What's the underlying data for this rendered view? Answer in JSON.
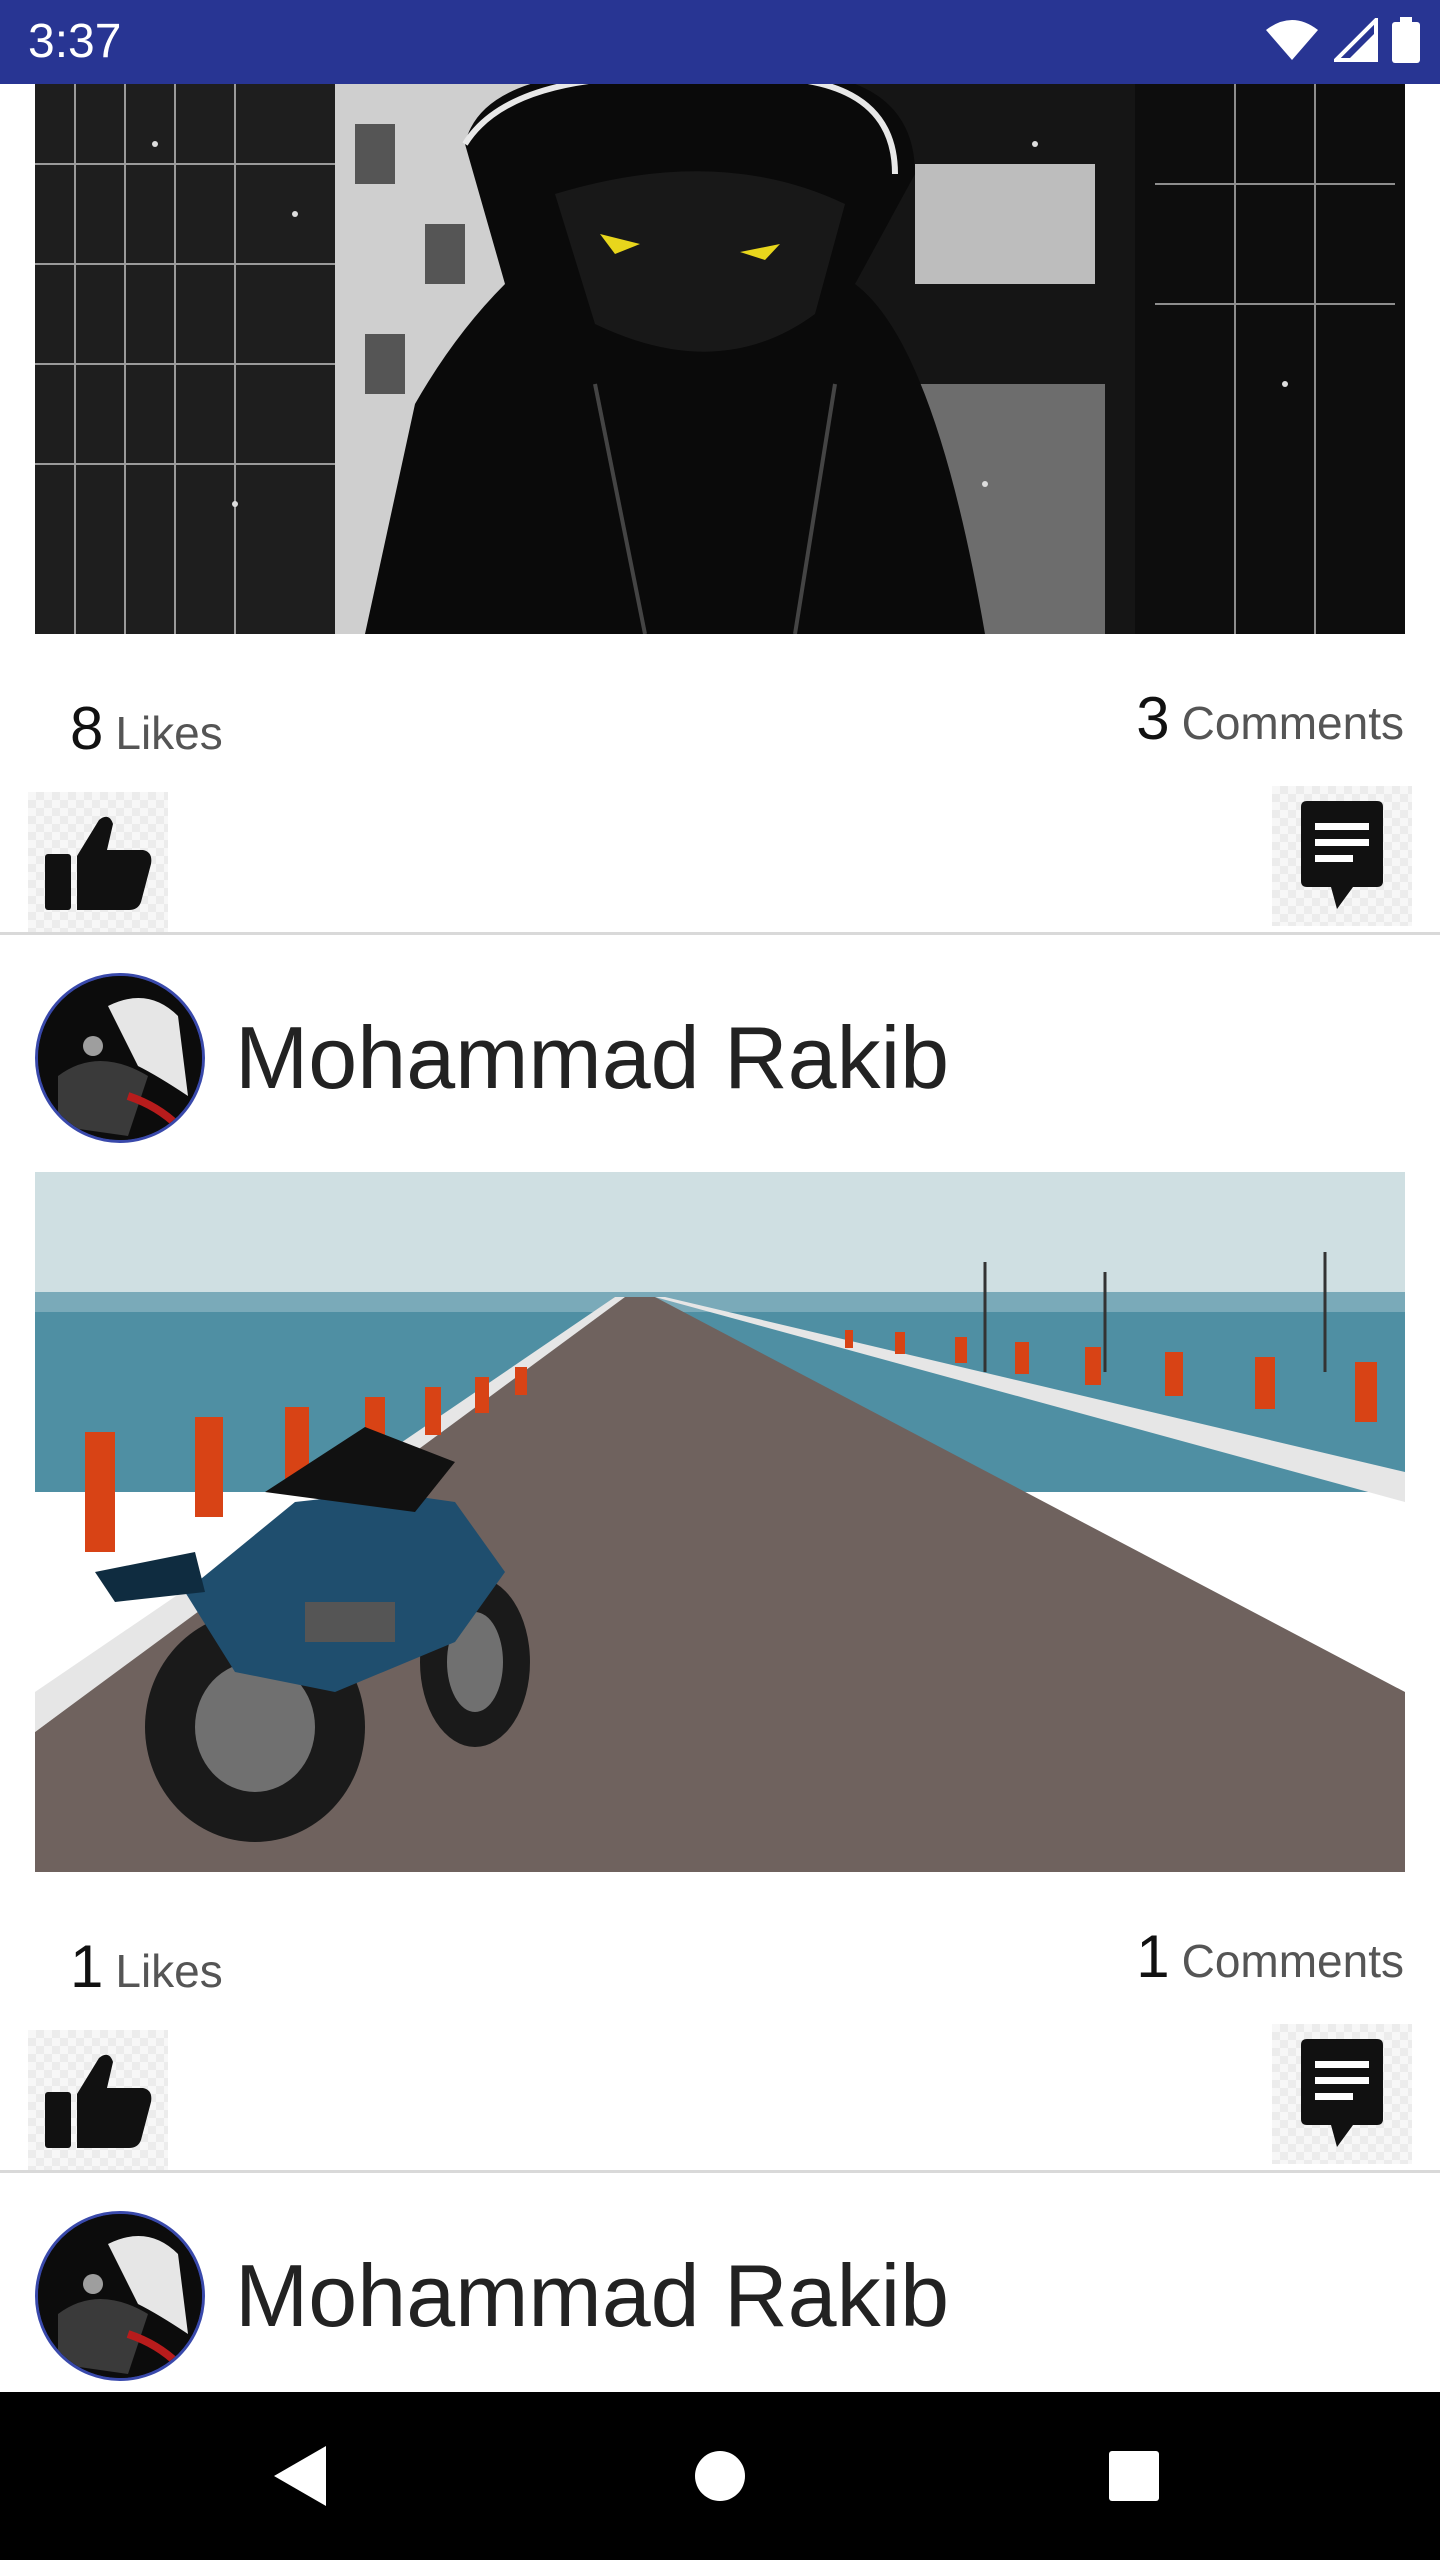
{
  "status_bar": {
    "time": "3:37",
    "icons": [
      "wifi-icon",
      "signal-icon",
      "battery-icon"
    ]
  },
  "posts": [
    {
      "author": "",
      "image": "hooded-anime-figure-city",
      "likes": {
        "count": "8",
        "label": "Likes"
      },
      "comments": {
        "count": "3",
        "label": "Comments"
      }
    },
    {
      "author": "Mohammad Rakib",
      "image": "motorcycle-on-sea-road",
      "likes": {
        "count": "1",
        "label": "Likes"
      },
      "comments": {
        "count": "1",
        "label": "Comments"
      }
    },
    {
      "author": "Mohammad Rakib"
    }
  ],
  "nav_bar": {
    "buttons": [
      "back-icon",
      "home-icon",
      "recents-icon"
    ]
  },
  "colors": {
    "status_bar": "#283593",
    "avatar_border": "#3949ab",
    "divider": "#d9d9d9"
  }
}
